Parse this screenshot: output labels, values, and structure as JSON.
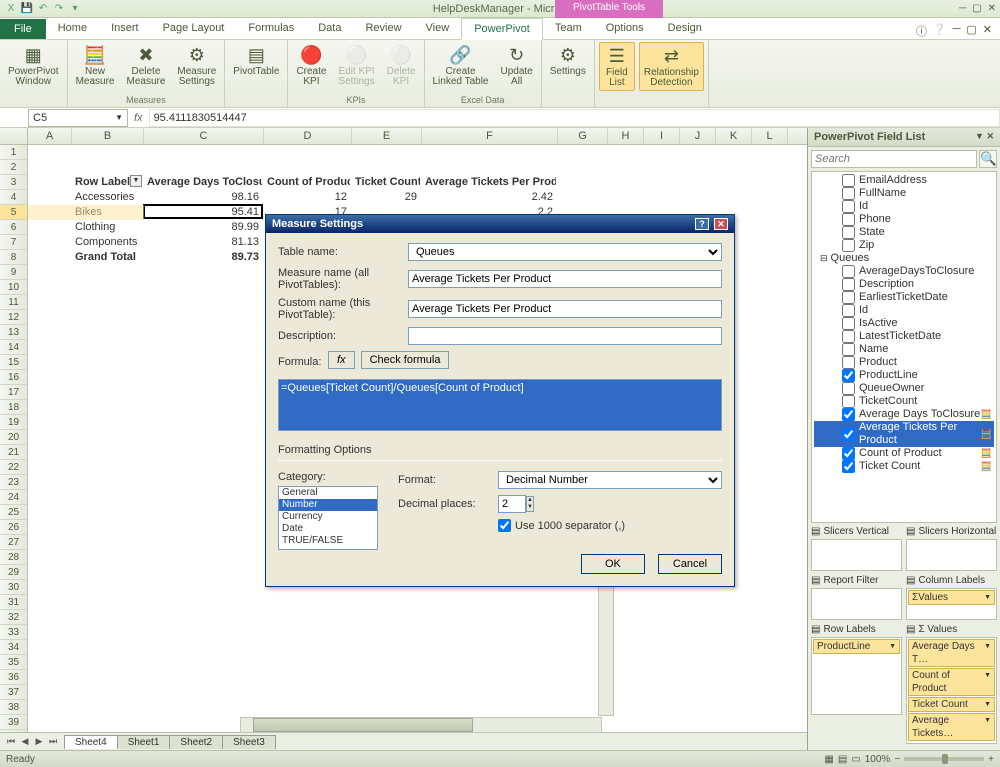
{
  "titlebar": {
    "title": "HelpDeskManager - Microsoft Excel",
    "context_tab": "PivotTable Tools"
  },
  "tabs": {
    "file": "File",
    "items": [
      "Home",
      "Insert",
      "Page Layout",
      "Formulas",
      "Data",
      "Review",
      "View",
      "PowerPivot",
      "Team",
      "Options",
      "Design"
    ],
    "active": "PowerPivot"
  },
  "ribbon": {
    "groups": [
      {
        "label": "",
        "items": [
          {
            "name": "powerpivot-window",
            "label": "PowerPivot\nWindow",
            "icon": "▦"
          }
        ]
      },
      {
        "label": "Measures",
        "items": [
          {
            "name": "new-measure",
            "label": "New\nMeasure",
            "icon": "🧮"
          },
          {
            "name": "delete-measure",
            "label": "Delete\nMeasure",
            "icon": "✖"
          },
          {
            "name": "measure-settings",
            "label": "Measure\nSettings",
            "icon": "⚙"
          }
        ]
      },
      {
        "label": "",
        "items": [
          {
            "name": "pivottable",
            "label": "PivotTable",
            "icon": "▤"
          }
        ]
      },
      {
        "label": "KPIs",
        "items": [
          {
            "name": "create-kpi",
            "label": "Create\nKPI",
            "icon": "🔴"
          },
          {
            "name": "edit-kpi",
            "label": "Edit KPI\nSettings",
            "icon": "⚪",
            "disabled": true
          },
          {
            "name": "delete-kpi",
            "label": "Delete\nKPI",
            "icon": "⚪",
            "disabled": true
          }
        ]
      },
      {
        "label": "Excel Data",
        "items": [
          {
            "name": "create-linked",
            "label": "Create\nLinked Table",
            "icon": "🔗"
          },
          {
            "name": "update-all",
            "label": "Update\nAll",
            "icon": "↻"
          }
        ]
      },
      {
        "label": "",
        "items": [
          {
            "name": "settings",
            "label": "Settings",
            "icon": "⚙"
          }
        ]
      },
      {
        "label": "",
        "items": [
          {
            "name": "field-list",
            "label": "Field\nList",
            "icon": "☰",
            "hl": true
          },
          {
            "name": "rel-detect",
            "label": "Relationship\nDetection",
            "icon": "⇄",
            "hl": true
          }
        ]
      }
    ]
  },
  "namebox": "C5",
  "formula": "95.4111830514447",
  "columns": [
    {
      "l": "A",
      "w": 44
    },
    {
      "l": "B",
      "w": 72
    },
    {
      "l": "C",
      "w": 120
    },
    {
      "l": "D",
      "w": 88
    },
    {
      "l": "E",
      "w": 70
    },
    {
      "l": "F",
      "w": 136
    },
    {
      "l": "G",
      "w": 50
    },
    {
      "l": "H",
      "w": 36
    },
    {
      "l": "I",
      "w": 36
    },
    {
      "l": "J",
      "w": 36
    },
    {
      "l": "K",
      "w": 36
    },
    {
      "l": "L",
      "w": 36
    }
  ],
  "pivot": {
    "headers": [
      "Row Labels",
      "Average Days ToClosure",
      "Count of Product",
      "Ticket Count",
      "Average Tickets Per Product"
    ],
    "rows": [
      {
        "label": "Accessories",
        "v": [
          "98.16",
          "12",
          "29",
          "2.42"
        ]
      },
      {
        "label": "Bikes",
        "v": [
          "95.41",
          "17",
          "",
          "2.2"
        ]
      },
      {
        "label": "Clothing",
        "v": [
          "89.99",
          "",
          "",
          ""
        ]
      },
      {
        "label": "Components",
        "v": [
          "81.13",
          "",
          "",
          ""
        ]
      },
      {
        "label": "Grand Total",
        "v": [
          "89.73",
          "",
          "",
          ""
        ],
        "bold": true
      }
    ]
  },
  "dialog": {
    "title": "Measure Settings",
    "table_label": "Table name:",
    "table": "Queues",
    "mname_label": "Measure name (all PivotTables):",
    "mname": "Average Tickets Per Product",
    "cname_label": "Custom name (this PivotTable):",
    "cname": "Average Tickets Per Product",
    "desc_label": "Description:",
    "desc": "",
    "formula_label": "Formula:",
    "fx": "fx",
    "check": "Check formula",
    "formula": "=Queues[Ticket Count]/Queues[Count of Product]",
    "fopts": "Formatting Options",
    "cat_label": "Category:",
    "categories": [
      "General",
      "Number",
      "Currency",
      "Date",
      "TRUE/FALSE"
    ],
    "cat_sel": "Number",
    "format_label": "Format:",
    "format": "Decimal Number",
    "dp_label": "Decimal places:",
    "dp": "2",
    "sep_label": "Use 1000 separator (,)",
    "ok": "OK",
    "cancel": "Cancel"
  },
  "fieldlist": {
    "title": "PowerPivot Field List",
    "search": "Search",
    "fields": [
      {
        "name": "EmailAddress",
        "chk": false,
        "indent": 28
      },
      {
        "name": "FullName",
        "chk": false,
        "indent": 28
      },
      {
        "name": "Id",
        "chk": false,
        "indent": 28
      },
      {
        "name": "Phone",
        "chk": false,
        "indent": 28
      },
      {
        "name": "State",
        "chk": false,
        "indent": 28
      },
      {
        "name": "Zip",
        "chk": false,
        "indent": 28
      },
      {
        "name": "Queues",
        "chk": false,
        "indent": 6,
        "group": true
      },
      {
        "name": "AverageDaysToClosure",
        "chk": false,
        "indent": 28
      },
      {
        "name": "Description",
        "chk": false,
        "indent": 28
      },
      {
        "name": "EarliestTicketDate",
        "chk": false,
        "indent": 28
      },
      {
        "name": "Id",
        "chk": false,
        "indent": 28
      },
      {
        "name": "IsActive",
        "chk": false,
        "indent": 28
      },
      {
        "name": "LatestTicketDate",
        "chk": false,
        "indent": 28
      },
      {
        "name": "Name",
        "chk": false,
        "indent": 28
      },
      {
        "name": "Product",
        "chk": false,
        "indent": 28
      },
      {
        "name": "ProductLine",
        "chk": true,
        "indent": 28
      },
      {
        "name": "QueueOwner",
        "chk": false,
        "indent": 28
      },
      {
        "name": "TicketCount",
        "chk": false,
        "indent": 28
      },
      {
        "name": "Average Days ToClosure",
        "chk": true,
        "indent": 28,
        "calc": true
      },
      {
        "name": "Average Tickets Per Product",
        "chk": true,
        "indent": 28,
        "calc": true,
        "sel": true
      },
      {
        "name": "Count of Product",
        "chk": true,
        "indent": 28,
        "calc": true
      },
      {
        "name": "Ticket Count",
        "chk": true,
        "indent": 28,
        "calc": true
      }
    ],
    "zones": {
      "slicersv": {
        "label": "Slicers Vertical",
        "items": []
      },
      "slicersh": {
        "label": "Slicers Horizontal",
        "items": []
      },
      "report": {
        "label": "Report Filter",
        "items": []
      },
      "collabels": {
        "label": "Column Labels",
        "items": [
          "ΣValues"
        ]
      },
      "rowlabels": {
        "label": "Row Labels",
        "items": [
          "ProductLine"
        ]
      },
      "values": {
        "label": "Σ  Values",
        "items": [
          "Average Days T…",
          "Count of Product",
          "Ticket Count",
          "Average Tickets…"
        ]
      }
    }
  },
  "sheettabs": [
    "Sheet4",
    "Sheet1",
    "Sheet2",
    "Sheet3"
  ],
  "status": {
    "ready": "Ready",
    "zoom": "100%"
  }
}
